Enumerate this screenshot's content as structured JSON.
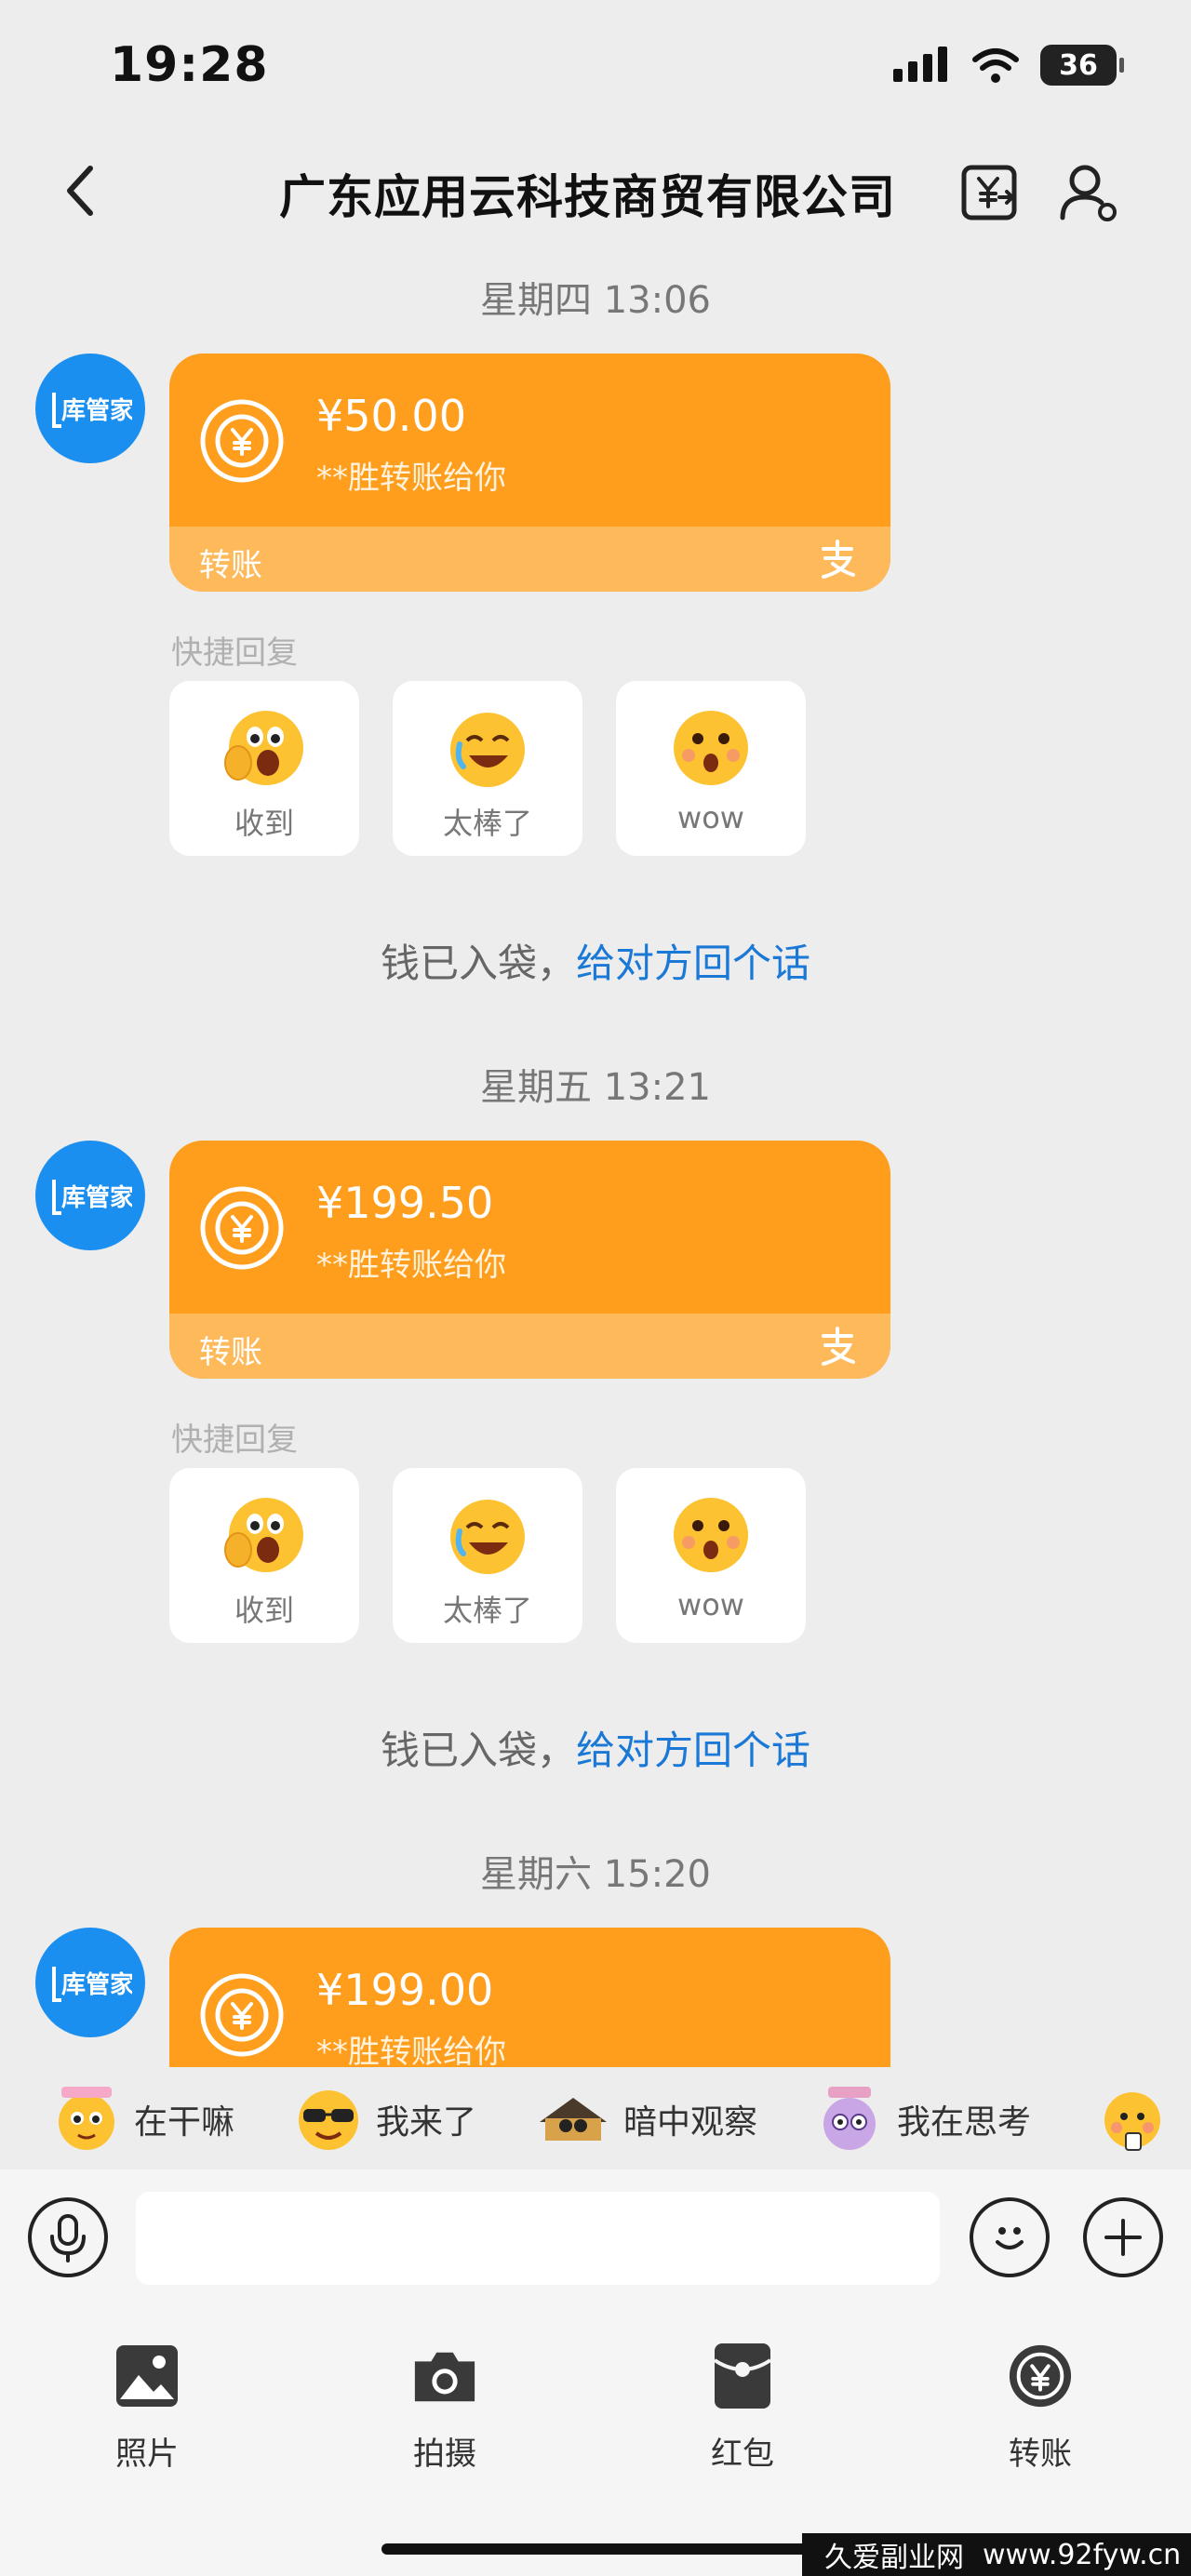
{
  "status_bar": {
    "time": "19:28",
    "battery": "36"
  },
  "nav": {
    "title": "广东应用云科技商贸有限公司"
  },
  "avatar": {
    "text": "库管家"
  },
  "messages": [
    {
      "time": "星期四 13:06",
      "amount": "¥50.00",
      "subtitle": "**胜转账给你",
      "footer_label": "转账",
      "quick_reply_label": "快捷回复",
      "quick_replies": [
        "收到",
        "太棒了",
        "wow"
      ],
      "receipt_text": "钱已入袋，",
      "receipt_link": "给对方回个话"
    },
    {
      "time": "星期五 13:21",
      "amount": "¥199.50",
      "subtitle": "**胜转账给你",
      "footer_label": "转账",
      "quick_reply_label": "快捷回复",
      "quick_replies": [
        "收到",
        "太棒了",
        "wow"
      ],
      "receipt_text": "钱已入袋，",
      "receipt_link": "给对方回个话"
    },
    {
      "time": "星期六 15:20",
      "amount": "¥199.00",
      "subtitle": "**胜转账给你"
    }
  ],
  "stickers": [
    "在干嘛",
    "我来了",
    "暗中观察",
    "我在思考"
  ],
  "input": {
    "placeholder": ""
  },
  "tools": [
    "照片",
    "拍摄",
    "红包",
    "转账"
  ],
  "watermark": {
    "site": "久爱副业网",
    "url": "www.92fyw.cn"
  },
  "colors": {
    "card": "#ff9d1c",
    "card_footer": "#fdb95a",
    "link": "#1a78d6",
    "avatar": "#1b8ff0"
  }
}
